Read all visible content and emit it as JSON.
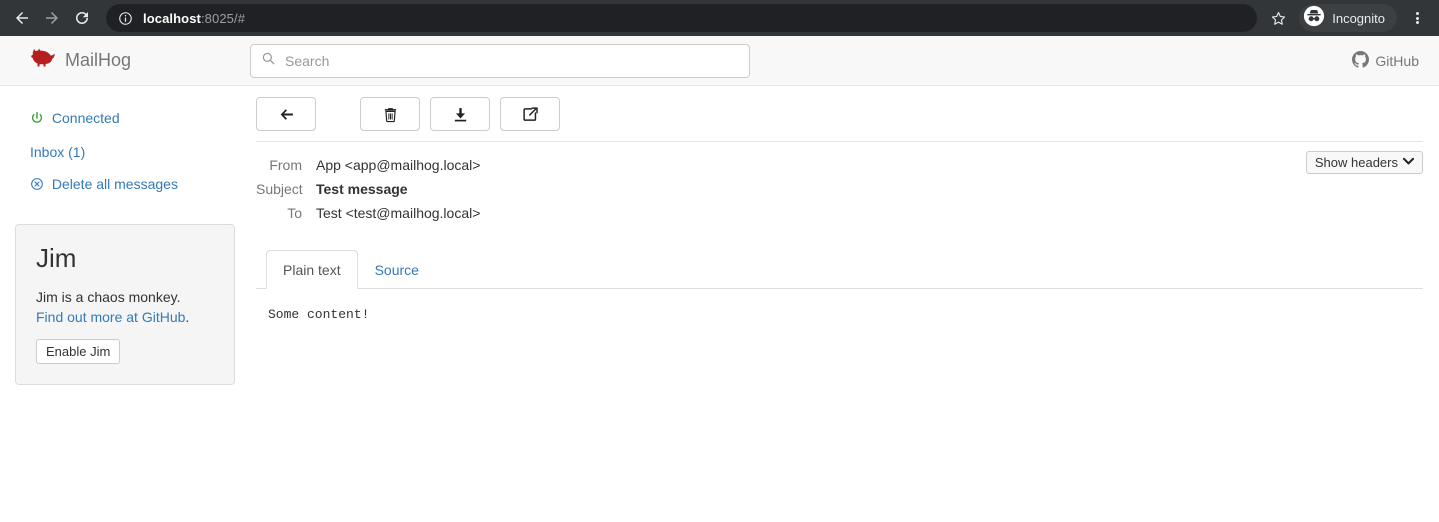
{
  "browser": {
    "back_icon": "arrow-left-icon",
    "forward_icon": "arrow-right-icon",
    "reload_icon": "reload-icon",
    "info_icon": "info-circle-icon",
    "url_host": "localhost",
    "url_rest": ":8025/#",
    "star_icon": "bookmark-star-icon",
    "incognito_label": "Incognito",
    "incognito_icon": "incognito-icon",
    "menu_icon": "kebab-menu-icon",
    "colors": {
      "chrome_bg": "#323639",
      "omnibox_bg": "#202124",
      "chip_bg": "#3c4043"
    }
  },
  "navbar": {
    "brand": "MailHog",
    "brand_icon": "pig-logo-icon",
    "brand_color": "#c00000",
    "search": {
      "placeholder": "Search",
      "value": "",
      "icon": "search-icon"
    },
    "github": {
      "label": "GitHub",
      "icon": "github-icon"
    }
  },
  "sidebar": {
    "status": {
      "label": "Connected",
      "icon": "power-icon",
      "icon_color": "#2e9e2e"
    },
    "inbox": {
      "label": "Inbox (1)",
      "count": 1
    },
    "delete_all": {
      "label": "Delete all messages",
      "icon": "circle-x-icon"
    },
    "jim": {
      "title": "Jim",
      "description": "Jim is a chaos monkey.",
      "link_label": "Find out more at GitHub",
      "description_suffix": ".",
      "button_label": "Enable Jim"
    }
  },
  "toolbar": {
    "back": {
      "label": "",
      "icon": "arrow-left-icon"
    },
    "delete": {
      "label": "",
      "icon": "trash-icon"
    },
    "download": {
      "label": "",
      "icon": "download-icon"
    },
    "release": {
      "label": "",
      "icon": "release-share-icon"
    }
  },
  "message": {
    "headers": [
      {
        "label": "From",
        "value": "App <app@mailhog.local>",
        "bold": false
      },
      {
        "label": "Subject",
        "value": "Test message",
        "bold": true
      },
      {
        "label": "To",
        "value": "Test <test@mailhog.local>",
        "bold": false
      }
    ],
    "show_headers": {
      "label": "Show headers",
      "caret": "❯"
    },
    "tabs": [
      {
        "label": "Plain text",
        "active": true
      },
      {
        "label": "Source",
        "active": false
      }
    ],
    "body": "Some content!"
  }
}
